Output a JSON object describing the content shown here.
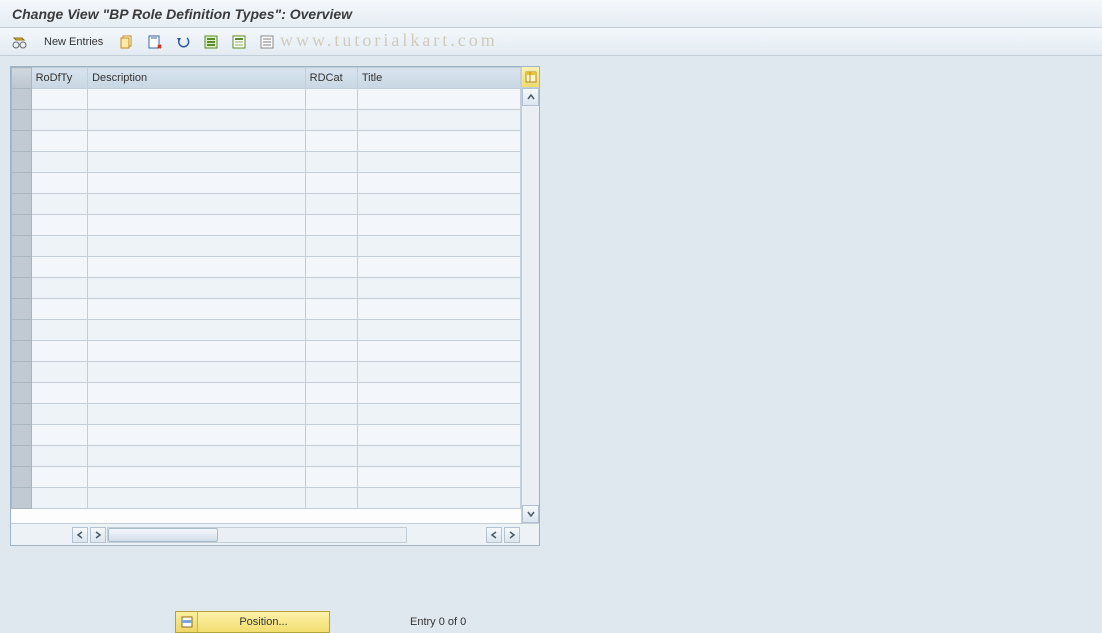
{
  "title": "Change View \"BP Role Definition Types\": Overview",
  "toolbar": {
    "new_entries_label": "New Entries"
  },
  "table": {
    "columns": {
      "rodfty": "RoDfTy",
      "description": "Description",
      "rdcat": "RDCat",
      "title": "Title"
    }
  },
  "footer": {
    "position_label": "Position...",
    "entry_text": "Entry 0 of 0"
  },
  "watermark": "www.tutorialkart.com"
}
